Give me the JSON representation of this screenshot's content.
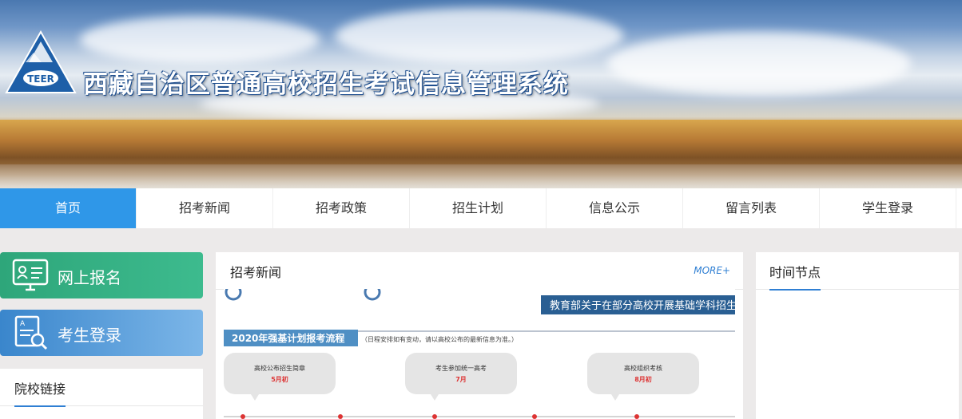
{
  "header": {
    "logo_text": "TEER",
    "title": "西藏自治区普通高校招生考试信息管理系统"
  },
  "nav": {
    "items": [
      "首页",
      "招考新闻",
      "招考政策",
      "招生计划",
      "信息公示",
      "留言列表",
      "学生登录"
    ],
    "active_index": 0
  },
  "sidebar": {
    "register_label": "网上报名",
    "login_label": "考生登录",
    "links_title": "院校链接"
  },
  "news": {
    "title": "招考新闻",
    "more": "MORE+",
    "image": {
      "banner_text": "教育部关于在部分高校开展基础学科招生改革",
      "flow_title": "2020年强基计划报考流程",
      "flow_note": "（日程安排如有变动，请以高校公布的最新信息为准。）",
      "steps": [
        {
          "label": "高校公布招生简章",
          "date": "5月初"
        },
        {
          "label": "考生参加统一高考",
          "date": "7月"
        },
        {
          "label": "高校组织考核",
          "date": "8月初"
        }
      ]
    }
  },
  "timeline": {
    "title": "时间节点"
  },
  "colors": {
    "nav_active": "#2f97e8",
    "accent": "#2f7fd3",
    "register_green": "#2ea67a",
    "login_blue": "#3a86cc"
  }
}
